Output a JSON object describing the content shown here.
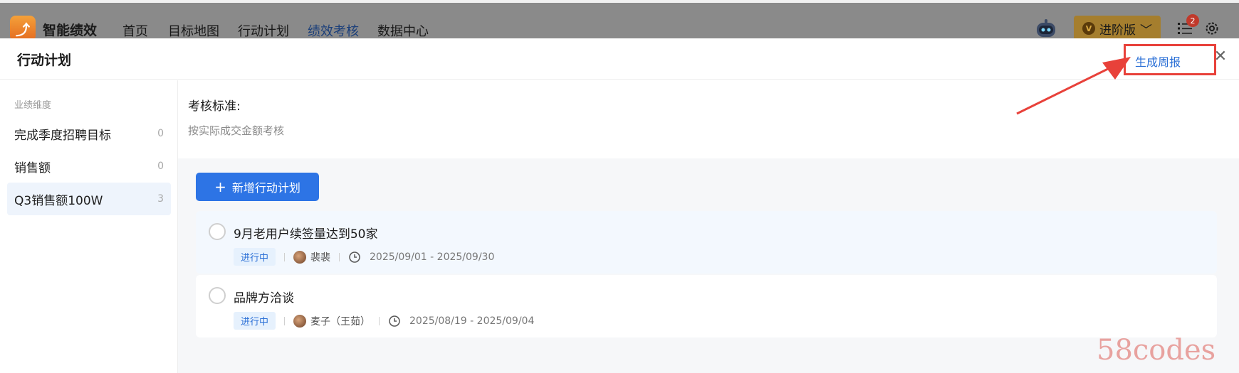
{
  "topnav": {
    "brand": "智能绩效",
    "items": [
      {
        "label": "首页",
        "active": false
      },
      {
        "label": "目标地图",
        "active": false
      },
      {
        "label": "行动计划",
        "active": false
      },
      {
        "label": "绩效考核",
        "active": true
      },
      {
        "label": "数据中心",
        "active": false
      }
    ],
    "plan_label": "进阶版",
    "notification_count": "2"
  },
  "drawer": {
    "title": "行动计划",
    "generate_report": "生成周报"
  },
  "sidebar": {
    "heading": "业绩维度",
    "items": [
      {
        "label": "完成季度招聘目标",
        "count": "0",
        "active": false
      },
      {
        "label": "销售额",
        "count": "0",
        "active": false
      },
      {
        "label": "Q3销售额100W",
        "count": "3",
        "active": true
      }
    ]
  },
  "criteria": {
    "label": "考核标准:",
    "text": "按实际成交金额考核"
  },
  "actions": {
    "add_label": "新增行动计划"
  },
  "plans": [
    {
      "title": "9月老用户续签量达到50家",
      "status": "进行中",
      "owner": "裴裴",
      "date_range": "2025/09/01 - 2025/09/30"
    },
    {
      "title": "品牌方洽谈",
      "status": "进行中",
      "owner": "麦子（王茹）",
      "date_range": "2025/08/19 - 2025/09/04"
    }
  ],
  "watermark": "58codes",
  "colors": {
    "accent": "#2d74e5",
    "link": "#2a6fd6",
    "highlight": "#e8413a",
    "premium": "#a57e2e"
  }
}
